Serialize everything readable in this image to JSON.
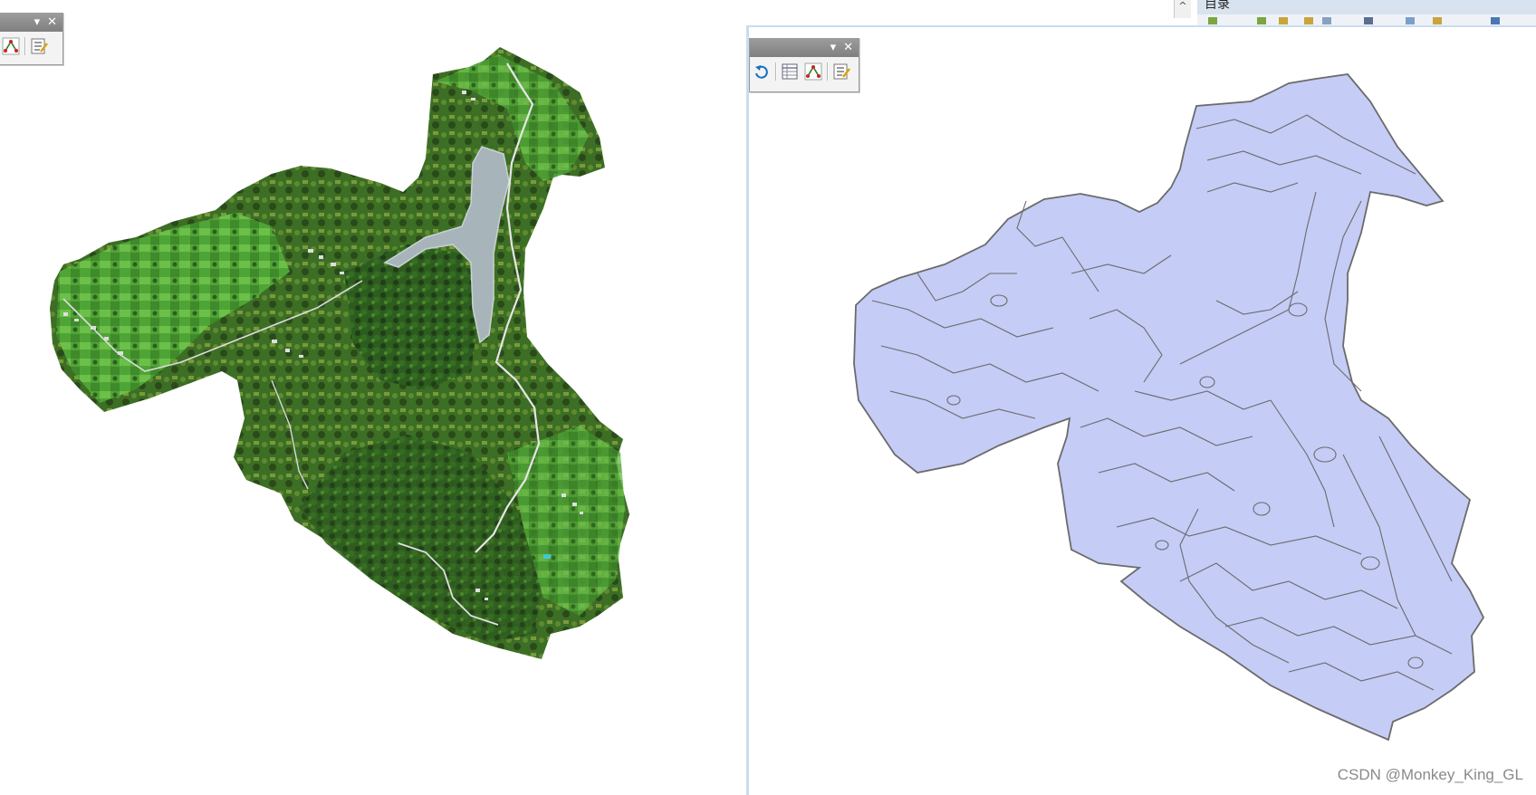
{
  "catalog": {
    "title": "目录",
    "scroll_up_glyph": "^"
  },
  "toolbar_left": {
    "dropdown_glyph": "▾",
    "close_glyph": "✕",
    "tools": [
      "edit-vertices-icon",
      "sketch-properties-icon"
    ]
  },
  "toolbar_right": {
    "dropdown_glyph": "▾",
    "close_glyph": "✕",
    "tools": [
      "rotate-icon",
      "attributes-table-icon",
      "edit-vertices-icon",
      "sketch-properties-icon"
    ]
  },
  "views": {
    "left": "satellite-imagery-map",
    "right": "vector-polygon-map"
  },
  "colors": {
    "polygon_fill": "#c5ccf6",
    "polygon_outline": "#6b6b6b",
    "imagery_dark": "#1f3d16",
    "imagery_green": "#3f9a2f",
    "water": "#a7b4b9"
  },
  "watermark": "CSDN @Monkey_King_GL"
}
